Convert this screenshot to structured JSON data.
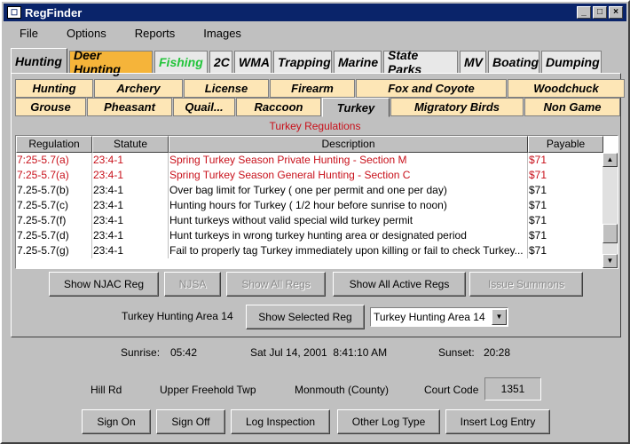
{
  "window": {
    "title": "RegFinder"
  },
  "menu": [
    "File",
    "Options",
    "Reports",
    "Images"
  ],
  "top_tabs": [
    {
      "label": "Hunting"
    },
    {
      "label": "Deer Hunting"
    },
    {
      "label": "Fishing"
    },
    {
      "label": "2C"
    },
    {
      "label": "WMA"
    },
    {
      "label": "Trapping"
    },
    {
      "label": "Marine"
    },
    {
      "label": "State Parks"
    },
    {
      "label": "MV"
    },
    {
      "label": "Boating"
    },
    {
      "label": "Dumping"
    }
  ],
  "sub_tabs_row1": [
    "Hunting",
    "Archery",
    "License",
    "Firearm",
    "Fox and Coyote",
    "Woodchuck"
  ],
  "sub_tabs_row2": [
    "Grouse",
    "Pheasant",
    "Quail...",
    "Raccoon",
    "Turkey",
    "Migratory Birds",
    "Non Game"
  ],
  "section_title": "Turkey Regulations",
  "table": {
    "headers": [
      "Regulation",
      "Statute",
      "Description",
      "Payable"
    ],
    "rows": [
      [
        "7:25-5.7(a)",
        "23:4-1",
        "Spring Turkey Season Private Hunting - Section M",
        "$71"
      ],
      [
        "7:25-5.7(a)",
        "23:4-1",
        "Spring Turkey Season General Hunting - Section C",
        "$71"
      ],
      [
        "7.25-5.7(b)",
        "23:4-1",
        "Over bag limit for Turkey ( one per permit and one per day)",
        "$71"
      ],
      [
        "7.25-5.7(c)",
        "23:4-1",
        "Hunting hours for Turkey ( 1/2 hour before sunrise to noon)",
        "$71"
      ],
      [
        "7.25-5.7(f)",
        "23:4-1",
        "Hunt turkeys without valid special wild turkey permit",
        "$71"
      ],
      [
        "7.25-5.7(d)",
        "23:4-1",
        "Hunt turkeys in wrong turkey hunting area or designated period",
        "$71"
      ],
      [
        "7.25-5.7(g)",
        "23:4-1",
        "Fail to properly tag Turkey immediately upon killing or fail to check Turkey...",
        "$71"
      ]
    ]
  },
  "buttons_row1": [
    "Show NJAC Reg",
    "NJSA",
    "Show All Regs",
    "Show All Active Regs",
    "Issue Summons"
  ],
  "area_label": "Turkey Hunting Area 14",
  "show_selected_label": "Show Selected Reg",
  "area_select": "Turkey Hunting Area 14",
  "sunrise_label": "Sunrise:",
  "sunrise": "05:42",
  "datetime": "Sat Jul 14, 2001  8:41:10 AM",
  "sunset_label": "Sunset:",
  "sunset": "20:28",
  "road": "Hill Rd",
  "township": "Upper Freehold Twp",
  "county": "Monmouth (County)",
  "court_code_label": "Court Code",
  "court_code": "1351",
  "bottom_buttons": [
    "Sign On",
    "Sign Off",
    "Log Inspection",
    "Other Log Type",
    "Insert Log Entry"
  ],
  "colors": {
    "title_bar": "#0a246a",
    "deer_tab": "#f5b43a",
    "fishing_text": "#22c43a",
    "sub_tab": "#fde6b6",
    "highlight_text": "#c8101a"
  }
}
